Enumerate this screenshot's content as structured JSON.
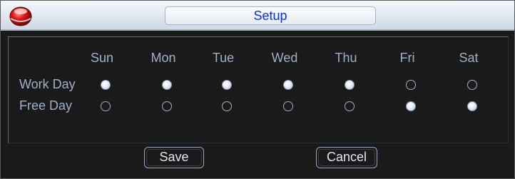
{
  "window": {
    "title": "Setup"
  },
  "days": [
    "Sun",
    "Mon",
    "Tue",
    "Wed",
    "Thu",
    "Fri",
    "Sat"
  ],
  "rows": [
    {
      "label": "Work Day",
      "selected": [
        true,
        true,
        true,
        true,
        true,
        false,
        false
      ]
    },
    {
      "label": "Free Day",
      "selected": [
        false,
        false,
        false,
        false,
        false,
        true,
        true
      ]
    }
  ],
  "buttons": {
    "save": "Save",
    "cancel": "Cancel"
  }
}
